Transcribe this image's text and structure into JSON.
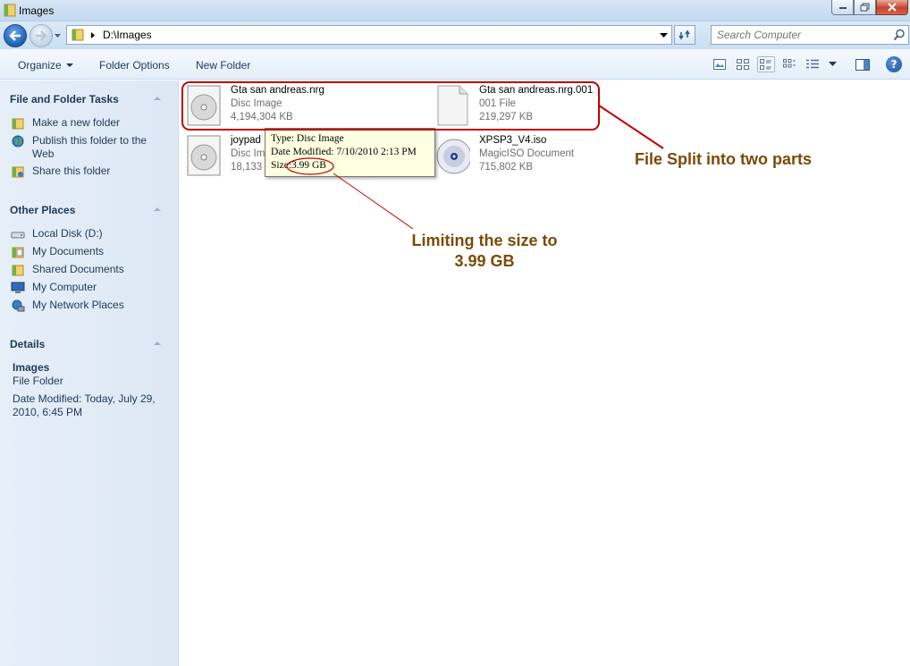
{
  "window": {
    "title": "Images"
  },
  "address": {
    "path": "D:\\Images"
  },
  "search": {
    "placeholder": "Search Computer"
  },
  "commandbar": {
    "organize": "Organize",
    "folder_options": "Folder Options",
    "new_folder": "New Folder"
  },
  "sidebar": {
    "file_tasks": {
      "title": "File and Folder Tasks",
      "items": [
        {
          "label": "Make a new folder",
          "icon": "new-folder-icon"
        },
        {
          "label": "Publish this folder to the Web",
          "icon": "globe-publish-icon"
        },
        {
          "label": "Share this folder",
          "icon": "share-icon"
        }
      ]
    },
    "other_places": {
      "title": "Other Places",
      "items": [
        {
          "label": "Local Disk (D:)",
          "icon": "drive-icon"
        },
        {
          "label": "My Documents",
          "icon": "documents-icon"
        },
        {
          "label": "Shared Documents",
          "icon": "shared-documents-icon"
        },
        {
          "label": "My Computer",
          "icon": "computer-icon"
        },
        {
          "label": "My Network Places",
          "icon": "network-icon"
        }
      ]
    },
    "details": {
      "title": "Details",
      "name": "Images",
      "type": "File Folder",
      "modified": "Date Modified: Today, July 29, 2010, 6:45 PM"
    }
  },
  "files": [
    {
      "name": "Gta san andreas.nrg",
      "type": "Disc Image",
      "size": "4,194,304 KB",
      "icon": "disc-image-icon"
    },
    {
      "name": "Gta san andreas.nrg.001",
      "type": "001 File",
      "size": "219,297 KB",
      "icon": "blank-file-icon"
    },
    {
      "name": "joypad",
      "type": "Disc Im",
      "size": "18,133",
      "icon": "disc-image-icon"
    },
    {
      "name": "XPSP3_V4.iso",
      "type": "MagicISO Document",
      "size": "715,802 KB",
      "icon": "cd-icon"
    }
  ],
  "tooltip": {
    "type": "Type: Disc Image",
    "modified": "Date Modified: 7/10/2010 2:13 PM",
    "size_label": "Size:",
    "size_value": "3.99 GB"
  },
  "annotations": {
    "split": "File Split into two parts",
    "limit_line1": "Limiting the size to",
    "limit_line2": "3.99 GB",
    "color": "#7b4a06",
    "line_color": "#c00000"
  }
}
